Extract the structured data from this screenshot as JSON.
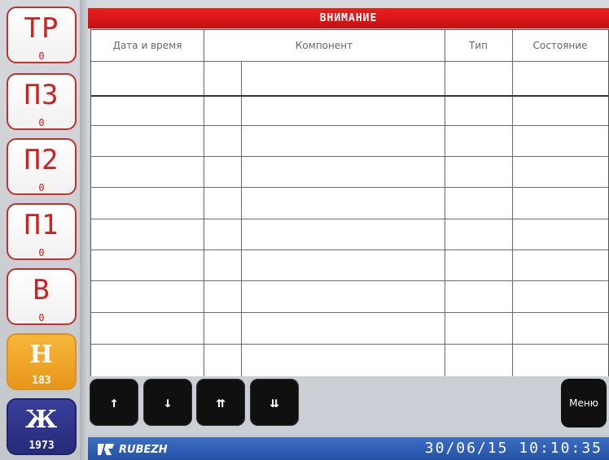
{
  "sidebar": {
    "buttons": [
      {
        "label": "ТР",
        "count": "0"
      },
      {
        "label": "П3",
        "count": "0"
      },
      {
        "label": "П2",
        "count": "0"
      },
      {
        "label": "П1",
        "count": "0"
      },
      {
        "label": "В",
        "count": "0"
      },
      {
        "label": "Н",
        "count": "183"
      },
      {
        "label": "Ж",
        "count": "1973"
      }
    ]
  },
  "header": {
    "title": "ВНИМАНИЕ"
  },
  "table": {
    "columns": [
      "Дата и время",
      "Компонент",
      "Тип",
      "Состояние"
    ]
  },
  "nav": {
    "up": "↑",
    "down": "↓",
    "top": "⇈",
    "bottom": "⇊",
    "menu": "Меню"
  },
  "footer": {
    "brand": "RUBEZH",
    "datetime": "30/06/15  10:10:35"
  },
  "colors": {
    "title_red": "#e11a1a",
    "sidebar_red": "#d02020",
    "yellow": "#f0a72a",
    "navy": "#2b2f86",
    "footer_blue": "#2f5fb6"
  }
}
